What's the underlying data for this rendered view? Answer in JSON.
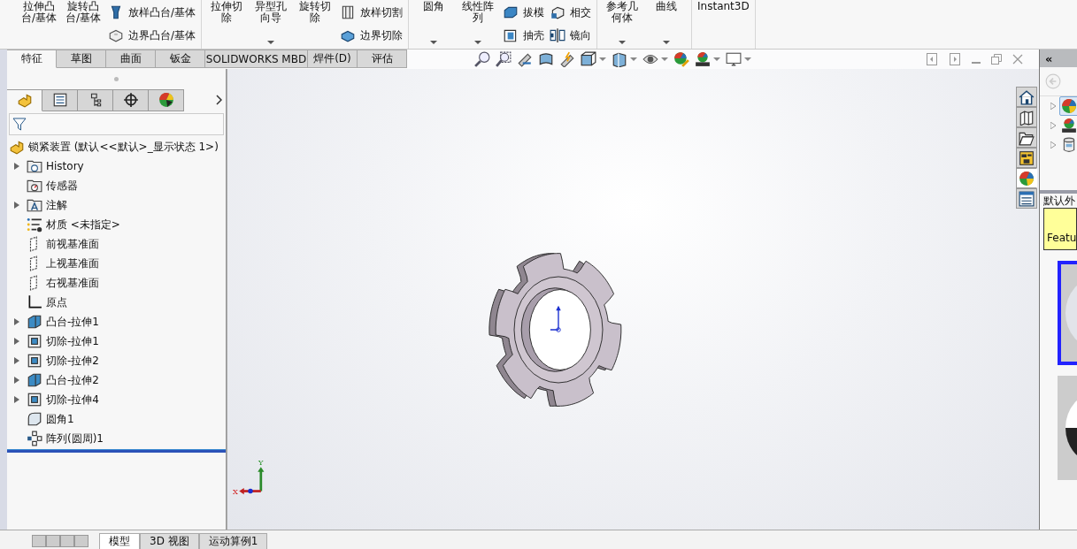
{
  "ribbon": {
    "groups": [
      {
        "items": [
          {
            "kind": "large",
            "label": "拉伸凸台/基体",
            "dropdown": false
          },
          {
            "kind": "large",
            "label": "旋转凸台/基体",
            "dropdown": false
          },
          {
            "kind": "stack",
            "items": [
              "放样凸台/基体",
              "边界凸台/基体"
            ]
          }
        ]
      },
      {
        "items": [
          {
            "kind": "large",
            "label": "拉伸切除",
            "dropdown": false
          },
          {
            "kind": "large",
            "label": "异型孔向导",
            "dropdown": true
          },
          {
            "kind": "large",
            "label": "旋转切除",
            "dropdown": false
          },
          {
            "kind": "stack",
            "items": [
              "放样切割",
              "边界切除"
            ]
          }
        ]
      },
      {
        "items": [
          {
            "kind": "large",
            "label": "圆角",
            "dropdown": true
          },
          {
            "kind": "large",
            "label": "线性阵列",
            "dropdown": true
          },
          {
            "kind": "stack",
            "items": [
              "拔模",
              "抽壳"
            ]
          },
          {
            "kind": "stack",
            "items": [
              "相交",
              "镜向"
            ]
          }
        ]
      },
      {
        "items": [
          {
            "kind": "large",
            "label": "参考几何体",
            "dropdown": true
          },
          {
            "kind": "large",
            "label": "曲线",
            "dropdown": true
          }
        ]
      },
      {
        "items": [
          {
            "kind": "wide",
            "label": "Instant3D",
            "dropdown": false
          }
        ]
      }
    ]
  },
  "tabs": [
    {
      "label": "特征",
      "selected": true
    },
    {
      "label": "草图",
      "selected": false
    },
    {
      "label": "曲面",
      "selected": false
    },
    {
      "label": "钣金",
      "selected": false
    },
    {
      "label": "SOLIDWORKS MBD",
      "selected": false
    },
    {
      "label": "焊件(D)",
      "selected": false
    },
    {
      "label": "评估",
      "selected": false
    }
  ],
  "panel_tabs": [
    {
      "kind": "feature",
      "selected": true
    },
    {
      "kind": "property",
      "selected": false
    },
    {
      "kind": "config",
      "selected": false
    },
    {
      "kind": "dimxpert",
      "selected": false
    },
    {
      "kind": "display",
      "selected": false
    }
  ],
  "tree": {
    "root": "锁紧装置  (默认<<默认>_显示状态 1>)",
    "items": [
      {
        "kind": "history",
        "label": "History",
        "expandable": true
      },
      {
        "kind": "sensor",
        "label": "传感器",
        "expandable": false
      },
      {
        "kind": "annotation",
        "label": "注解",
        "expandable": true
      },
      {
        "kind": "material",
        "label": "材质 <未指定>",
        "expandable": false
      },
      {
        "kind": "plane",
        "label": "前视基准面",
        "expandable": false
      },
      {
        "kind": "plane",
        "label": "上视基准面",
        "expandable": false
      },
      {
        "kind": "plane",
        "label": "右视基准面",
        "expandable": false
      },
      {
        "kind": "origin",
        "label": "原点",
        "expandable": false
      },
      {
        "kind": "boss",
        "label": "凸台-拉伸1",
        "expandable": true
      },
      {
        "kind": "cut",
        "label": "切除-拉伸1",
        "expandable": true
      },
      {
        "kind": "cut",
        "label": "切除-拉伸2",
        "expandable": true
      },
      {
        "kind": "boss",
        "label": "凸台-拉伸2",
        "expandable": true
      },
      {
        "kind": "cut",
        "label": "切除-拉伸4",
        "expandable": true
      },
      {
        "kind": "fillet",
        "label": "圆角1",
        "expandable": false
      },
      {
        "kind": "pattern",
        "label": "阵列(圆周)1",
        "expandable": false
      }
    ]
  },
  "triad": {
    "x": "X",
    "y": "Y"
  },
  "task_pane": {
    "header": "«",
    "tabs": [
      {
        "kind": "home",
        "selected": false
      },
      {
        "kind": "library",
        "selected": false
      },
      {
        "kind": "folder",
        "selected": false
      },
      {
        "kind": "palette",
        "selected": false
      },
      {
        "kind": "appearance",
        "selected": true
      },
      {
        "kind": "properties",
        "selected": false
      }
    ],
    "items": [
      {
        "kind": "appearance",
        "selected": true
      },
      {
        "kind": "scene",
        "selected": false
      },
      {
        "kind": "decal",
        "selected": false
      }
    ],
    "caption": "默认外",
    "note": "Featu",
    "thumbnails": [
      {
        "selected": true
      },
      {
        "selected": false
      }
    ]
  },
  "bottom_tabs": [
    {
      "label": "模型",
      "selected": true
    },
    {
      "label": "3D 视图",
      "selected": false
    },
    {
      "label": "运动算例1",
      "selected": false
    }
  ]
}
